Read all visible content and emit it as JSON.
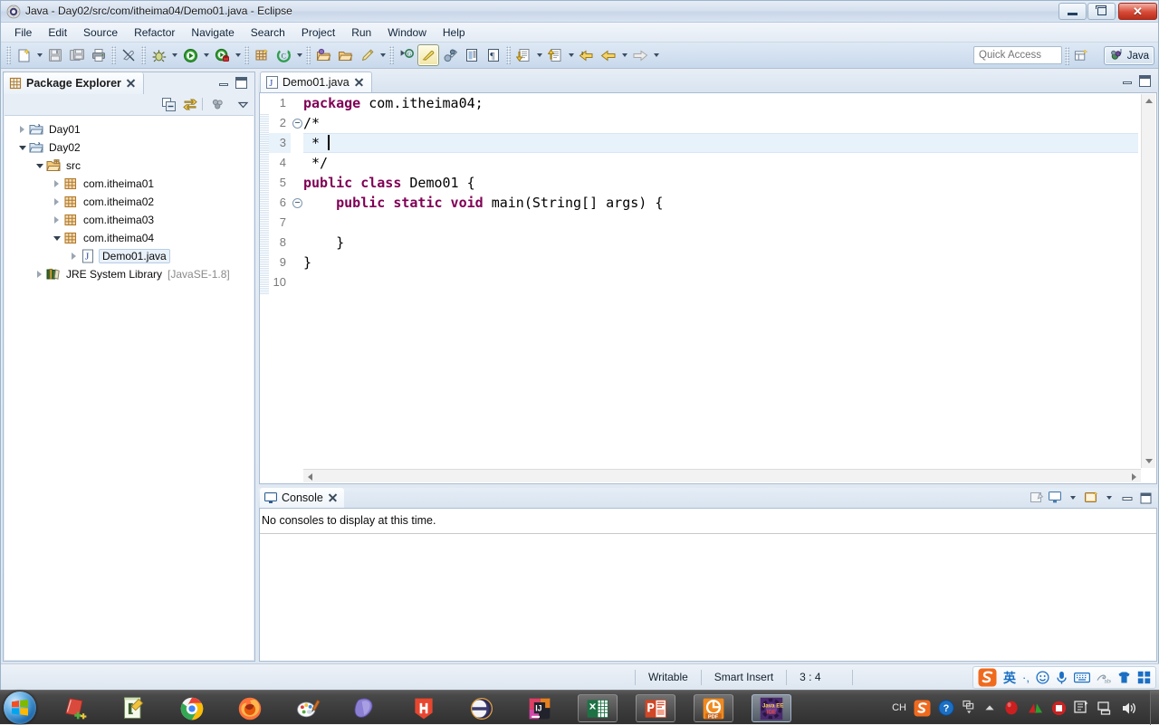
{
  "window": {
    "title": "Java - Day02/src/com/itheima04/Demo01.java - Eclipse",
    "controls": {
      "minimize": "Minimize",
      "maximize": "Restore",
      "close": "Close"
    }
  },
  "menubar": {
    "items": [
      "File",
      "Edit",
      "Source",
      "Refactor",
      "Navigate",
      "Search",
      "Project",
      "Run",
      "Window",
      "Help"
    ]
  },
  "toolbar": {
    "icons": [
      "new-wizard-icon",
      "save-icon",
      "save-all-icon",
      "print-icon",
      "toggle-mark-occurrences-icon",
      "debug-icon",
      "run-icon",
      "coverage-icon",
      "new-java-package-icon",
      "new-java-class-icon",
      "open-type-icon",
      "open-task-icon",
      "search-icon",
      "next-annotation-icon",
      "previous-annotation-icon",
      "last-edit-location-icon",
      "toggle-block-selection-icon",
      "show-whitespace-icon",
      "back-icon",
      "forward-icon",
      "next-edit-icon",
      "previous-edit-icon"
    ],
    "quick_access_placeholder": "Quick Access",
    "open_perspective": "Open Perspective",
    "perspective_label": "Java"
  },
  "explorer": {
    "tab_label": "Package Explorer",
    "toolbar_icons": [
      "collapse-all-icon",
      "link-with-editor-icon",
      "view-menu-icon",
      "chevron-down-icon"
    ],
    "tree": [
      {
        "label": "Day01",
        "indent": 0,
        "icon": "project-folder-icon",
        "state": "collapsed",
        "selected": false,
        "dim": ""
      },
      {
        "label": "Day02",
        "indent": 0,
        "icon": "project-folder-icon",
        "state": "expanded",
        "selected": false,
        "dim": ""
      },
      {
        "label": "src",
        "indent": 1,
        "icon": "source-folder-icon",
        "state": "expanded",
        "selected": false,
        "dim": ""
      },
      {
        "label": "com.itheima01",
        "indent": 2,
        "icon": "package-icon",
        "state": "collapsed",
        "selected": false,
        "dim": ""
      },
      {
        "label": "com.itheima02",
        "indent": 2,
        "icon": "package-icon",
        "state": "collapsed",
        "selected": false,
        "dim": ""
      },
      {
        "label": "com.itheima03",
        "indent": 2,
        "icon": "package-icon",
        "state": "collapsed",
        "selected": false,
        "dim": ""
      },
      {
        "label": "com.itheima04",
        "indent": 2,
        "icon": "package-icon",
        "state": "expanded",
        "selected": false,
        "dim": ""
      },
      {
        "label": "Demo01.java",
        "indent": 3,
        "icon": "java-file-icon",
        "state": "collapsed",
        "selected": true,
        "dim": ""
      },
      {
        "label": "JRE System Library",
        "indent": 1,
        "icon": "jre-library-icon",
        "state": "collapsed",
        "selected": false,
        "dim": "[JavaSE-1.8]"
      }
    ]
  },
  "editor": {
    "tab_label": "Demo01.java",
    "tab_icon": "java-file-icon",
    "lines": [
      {
        "num": "1",
        "fold": false,
        "highlight": false,
        "tokens": [
          {
            "t": "package ",
            "k": true
          },
          {
            "t": "com.itheima04;",
            "k": false
          }
        ]
      },
      {
        "num": "2",
        "fold": true,
        "highlight": false,
        "tokens": [
          {
            "t": "/*",
            "k": false
          }
        ]
      },
      {
        "num": "3",
        "fold": false,
        "highlight": true,
        "tokens": [
          {
            "t": " * ",
            "k": false
          }
        ]
      },
      {
        "num": "4",
        "fold": false,
        "highlight": false,
        "tokens": [
          {
            "t": " */",
            "k": false
          }
        ]
      },
      {
        "num": "5",
        "fold": false,
        "highlight": false,
        "tokens": [
          {
            "t": "public class ",
            "k": true
          },
          {
            "t": "Demo01 {",
            "k": false
          }
        ]
      },
      {
        "num": "6",
        "fold": true,
        "highlight": false,
        "tokens": [
          {
            "t": "    ",
            "k": false
          },
          {
            "t": "public static void ",
            "k": true
          },
          {
            "t": "main(String[] args) {",
            "k": false
          }
        ]
      },
      {
        "num": "7",
        "fold": false,
        "highlight": false,
        "tokens": [
          {
            "t": "",
            "k": false
          }
        ]
      },
      {
        "num": "8",
        "fold": false,
        "highlight": false,
        "tokens": [
          {
            "t": "    }",
            "k": false
          }
        ]
      },
      {
        "num": "9",
        "fold": false,
        "highlight": false,
        "tokens": [
          {
            "t": "}",
            "k": false
          }
        ]
      },
      {
        "num": "10",
        "fold": false,
        "highlight": false,
        "tokens": [
          {
            "t": "",
            "k": false
          }
        ]
      }
    ],
    "colors": {
      "keyword": "#7f0055",
      "text": "#000000",
      "line_number": "#7a7a7a",
      "current_line": "#e8f2fb"
    }
  },
  "console": {
    "tab_label": "Console",
    "tab_icon": "console-icon",
    "message": "No consoles to display at this time.",
    "toolbar_icons": [
      "clear-console-icon",
      "display-selected-console-icon",
      "chevron-down-icon",
      "open-console-icon",
      "chevron-down-icon",
      "minimize-icon",
      "maximize-icon"
    ]
  },
  "statusbar": {
    "writable": "Writable",
    "insert_mode": "Smart Insert",
    "cursor_position": "3 : 4",
    "ime": {
      "logo": "sogou-logo-icon",
      "mode": "英",
      "icons": [
        "punctuation-icon",
        "emoji-icon",
        "voice-input-icon",
        "soft-keyboard-icon",
        "handwriting-icon",
        "skin-icon",
        "toolbox-icon"
      ]
    }
  },
  "taskbar": {
    "start": "start-orb-icon",
    "items": [
      {
        "name": "notepad-plus-plus-icon",
        "state": "pinned"
      },
      {
        "name": "editplus-icon",
        "state": "pinned"
      },
      {
        "name": "google-chrome-icon",
        "state": "pinned"
      },
      {
        "name": "firefox-icon",
        "state": "pinned"
      },
      {
        "name": "paint-icon",
        "state": "pinned"
      },
      {
        "name": "photoshop-icon",
        "state": "pinned"
      },
      {
        "name": "hbuilder-icon",
        "state": "pinned"
      },
      {
        "name": "eclipse-icon",
        "state": "pinned"
      },
      {
        "name": "intellij-idea-icon",
        "state": "pinned"
      },
      {
        "name": "excel-icon",
        "state": "running"
      },
      {
        "name": "powerpoint-icon",
        "state": "running"
      },
      {
        "name": "foxit-pdf-icon",
        "state": "running"
      },
      {
        "name": "java-ee-ide-icon",
        "state": "active"
      }
    ],
    "tray": {
      "language": "CH",
      "icons": [
        "sogou-tray-icon",
        "help-icon",
        "show-hidden-icon",
        "up-arrow-icon",
        "red-shield-icon",
        "antivirus-icon",
        "stop-icon",
        "network-manager-icon",
        "network-icon",
        "volume-icon"
      ]
    }
  }
}
